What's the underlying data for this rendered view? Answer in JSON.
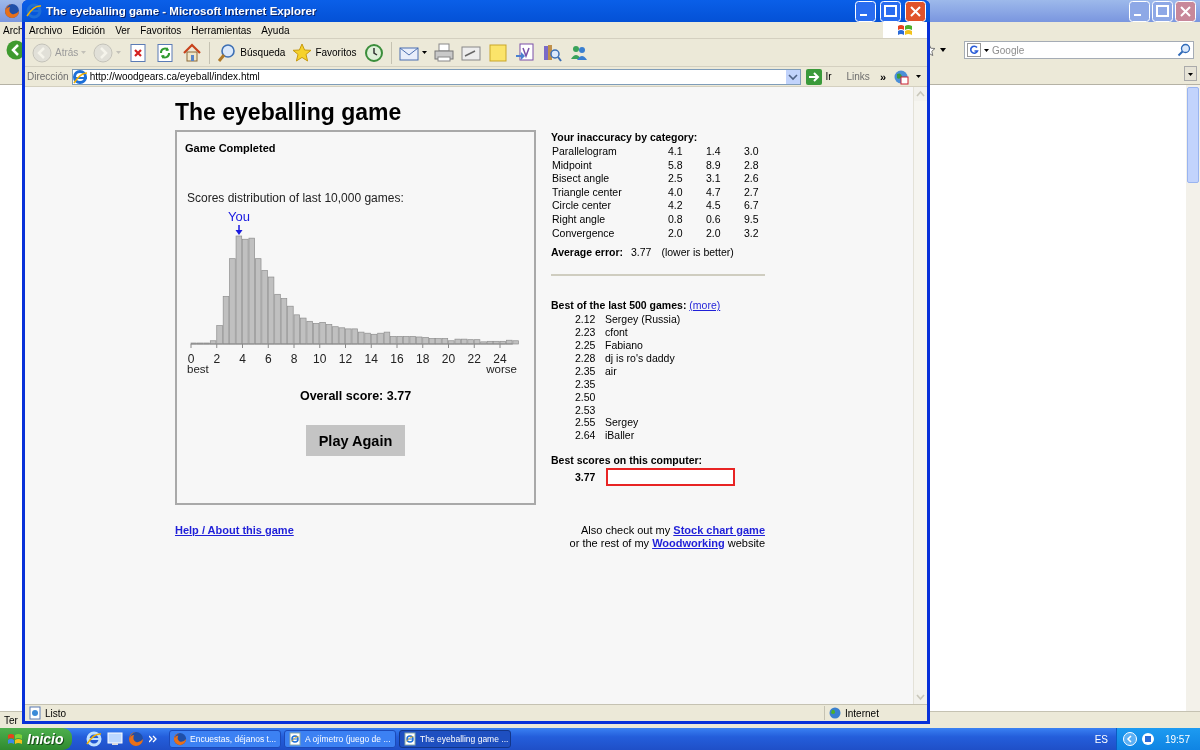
{
  "background_window": {
    "menu_fragment": "Arch",
    "search": {
      "placeholder": "Google"
    },
    "status_fragment": "Ter"
  },
  "window": {
    "title": "The eyeballing game - Microsoft Internet Explorer"
  },
  "menu": [
    "Archivo",
    "Edición",
    "Ver",
    "Favoritos",
    "Herramientas",
    "Ayuda"
  ],
  "toolbar": [
    {
      "kind": "back",
      "label": "Atrás",
      "disabled": true
    },
    {
      "kind": "forward",
      "disabled": true
    },
    {
      "kind": "stop",
      "disabled": false
    },
    {
      "kind": "refresh",
      "disabled": false
    },
    {
      "kind": "home",
      "disabled": false
    },
    {
      "kind": "separator"
    },
    {
      "kind": "search",
      "label": "Búsqueda",
      "disabled": false
    },
    {
      "kind": "favorites",
      "label": "Favoritos",
      "disabled": false
    },
    {
      "kind": "history",
      "disabled": false
    },
    {
      "kind": "separator"
    },
    {
      "kind": "mail",
      "disabled": false
    },
    {
      "kind": "print",
      "disabled": false
    },
    {
      "kind": "edit",
      "disabled": false
    },
    {
      "kind": "note",
      "disabled": false
    },
    {
      "kind": "document",
      "disabled": false
    },
    {
      "kind": "research",
      "disabled": false
    },
    {
      "kind": "messenger",
      "disabled": false
    }
  ],
  "address": {
    "label": "Dirección",
    "url": "http://woodgears.ca/eyeball/index.html",
    "go": "Ir",
    "links": "Links",
    "more": "»"
  },
  "page": {
    "title": "The eyeballing game",
    "game": {
      "heading": "Game Completed",
      "caption": "Scores distribution of last 10,000 games:",
      "marker": "You",
      "x_ticks": [
        "0",
        "2",
        "4",
        "6",
        "8",
        "10",
        "12",
        "14",
        "16",
        "18",
        "20",
        "22",
        "24"
      ],
      "axis_start": "best",
      "axis_end": "worse",
      "overall": "Overall score: 3.77",
      "button": "Play Again"
    },
    "inaccuracy": {
      "heading": "Your inaccuracy by category:",
      "rows": [
        {
          "name": "Parallelogram",
          "values": [
            "4.1",
            "1.4",
            "3.0"
          ]
        },
        {
          "name": "Midpoint",
          "values": [
            "5.8",
            "8.9",
            "2.8"
          ]
        },
        {
          "name": "Bisect angle",
          "values": [
            "2.5",
            "3.1",
            "2.6"
          ]
        },
        {
          "name": "Triangle center",
          "values": [
            "4.0",
            "4.7",
            "2.7"
          ]
        },
        {
          "name": "Circle center",
          "values": [
            "4.2",
            "4.5",
            "6.7"
          ]
        },
        {
          "name": "Right angle",
          "values": [
            "0.8",
            "0.6",
            "9.5"
          ]
        },
        {
          "name": "Convergence",
          "values": [
            "2.0",
            "2.0",
            "3.2"
          ]
        }
      ],
      "average_label": "Average error:",
      "average": "3.77",
      "note": "(lower is better)"
    },
    "best": {
      "heading": "Best of the last 500 games:",
      "more": "(more)",
      "rows": [
        {
          "score": "2.12",
          "name": "Sergey (Russia)"
        },
        {
          "score": "2.23",
          "name": "cfont"
        },
        {
          "score": "2.25",
          "name": "Fabiano"
        },
        {
          "score": "2.28",
          "name": "dj is ro's daddy"
        },
        {
          "score": "2.35",
          "name": "air"
        },
        {
          "score": "2.35"
        },
        {
          "score": "2.50"
        },
        {
          "score": "2.53"
        },
        {
          "score": "2.55",
          "name": "Sergey"
        },
        {
          "score": "2.64",
          "name": "iBaller"
        }
      ]
    },
    "local": {
      "heading": "Best scores on this computer:",
      "score": "3.77"
    },
    "help_link": "Help / About this game",
    "footer": [
      {
        "text": "Also check out my",
        "link": "Stock chart game"
      },
      {
        "text": "or the rest of my",
        "link": "Woodworking",
        "after": "website"
      }
    ]
  },
  "status_bar": {
    "text": "Listo",
    "zone": "Internet"
  },
  "taskbar": {
    "start": "Inicio",
    "tasks": [
      {
        "label": "Encuestas, déjanos t...",
        "selected": false
      },
      {
        "label": "A ojímetro (juego de ...",
        "selected": false
      },
      {
        "label": "The eyeballing game ...",
        "selected": true
      }
    ],
    "language": "ES",
    "clock": "19:57"
  }
}
